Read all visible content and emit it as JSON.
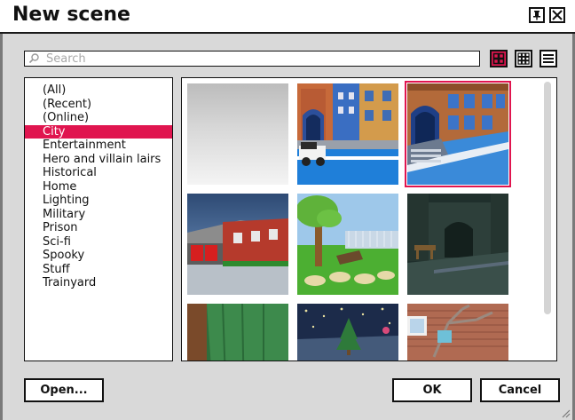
{
  "window": {
    "title": "New scene"
  },
  "titlebar_buttons": [
    {
      "icon": "pin-icon"
    },
    {
      "icon": "close-icon"
    }
  ],
  "search": {
    "placeholder": "Search",
    "value": "",
    "icon": "search-icon"
  },
  "view_modes": [
    {
      "icon": "large-grid-icon",
      "active": true
    },
    {
      "icon": "small-grid-icon",
      "active": false
    },
    {
      "icon": "list-view-icon",
      "active": false
    }
  ],
  "categories": [
    {
      "label": "(All)"
    },
    {
      "label": "(Recent)"
    },
    {
      "label": "(Online)"
    },
    {
      "label": "City",
      "selected": true
    },
    {
      "label": "Entertainment"
    },
    {
      "label": "Hero and villain lairs"
    },
    {
      "label": "Historical"
    },
    {
      "label": "Home"
    },
    {
      "label": "Lighting"
    },
    {
      "label": "Military"
    },
    {
      "label": "Prison"
    },
    {
      "label": "Sci-fi"
    },
    {
      "label": "Spooky"
    },
    {
      "label": "Stuff"
    },
    {
      "label": "Trainyard"
    }
  ],
  "scenes": [
    {
      "thumbnail": "blank-grey-scene",
      "selected": false
    },
    {
      "thumbnail": "city-street-with-car",
      "selected": false
    },
    {
      "thumbnail": "city-street-steps",
      "selected": true
    },
    {
      "thumbnail": "fire-station-brick-building",
      "selected": false
    },
    {
      "thumbnail": "park-with-tree",
      "selected": false
    },
    {
      "thumbnail": "dark-haunted-house",
      "selected": false
    },
    {
      "thumbnail": "green-curtain-room",
      "selected": false
    },
    {
      "thumbnail": "night-christmas-tree",
      "selected": false
    },
    {
      "thumbnail": "brick-wall-bare-tree",
      "selected": false
    }
  ],
  "buttons": {
    "open": "Open...",
    "ok": "OK",
    "cancel": "Cancel"
  },
  "colors": {
    "accent": "#e0154f",
    "dialog_bg": "#d9d9d9"
  }
}
